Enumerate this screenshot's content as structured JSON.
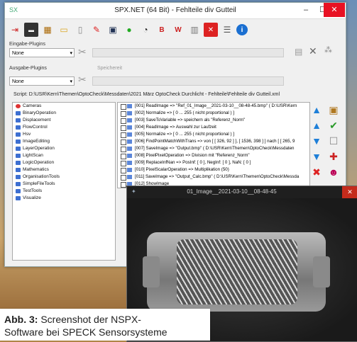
{
  "window": {
    "title": "SPX.NET (64 Bit) - Fehlteile div Gutteil",
    "app_icon": "SX",
    "controls": {
      "minimize": "–",
      "maximize": "☐",
      "close": "✕"
    }
  },
  "toolbar_icons": [
    "exit-icon",
    "screen-icon",
    "calculator-icon",
    "open-folder-icon",
    "new-document-icon",
    "pen-icon",
    "save-icon",
    "run-icon",
    "timer-icon",
    "record-icon",
    "stop-w-icon",
    "database-icon",
    "delete-icon",
    "list-icon",
    "info-icon"
  ],
  "input_plugins": {
    "label": "Eingabe-Plugins",
    "value": "None"
  },
  "output_plugins": {
    "label": "Ausgabe-Plugins",
    "value": "None",
    "storage_label": "Speichereit"
  },
  "script_path": "Script: D:\\USR\\Kern\\Themen\\OptoCheck\\Messdaten\\2021 März OptoCheck Durchlicht - Fehlteile\\Fehlteile div Gutteil.xml",
  "categories": [
    {
      "label": "Cameras",
      "icon": "camera-icon"
    },
    {
      "label": "BinaryOperation"
    },
    {
      "label": "Displacement"
    },
    {
      "label": "FlowControl"
    },
    {
      "label": "Hsv"
    },
    {
      "label": "ImageEditing"
    },
    {
      "label": "LayerOperation"
    },
    {
      "label": "LightScan"
    },
    {
      "label": "LogicOperation"
    },
    {
      "label": "Mathematics"
    },
    {
      "label": "OrganisationTools"
    },
    {
      "label": "SimpleFileTools"
    },
    {
      "label": "TestTools"
    },
    {
      "label": "Visualize"
    }
  ],
  "steps": [
    "[001] ReadImage => \"Ref_01_Image__2021-03-10__08-48-45.bmp\" ( D:\\USR\\Kern",
    "[002] Normalize => [ 0 ... 255 ( nicht proportional ) ]",
    "[003] SaveToVariable => speichern als \"Referenz_Norm\"",
    "[004] ReadImage => Auswahl zur Laufzeit",
    "[005] Normalize => [ 0 ... 255 ( nicht proportional ) ]",
    "[006] FindPointMatchWithTrans => von [ [ 326, 92 ] ], [ 1536, 398 ] ] nach [ [ 265, 9",
    "[007] SaveImage => \"Output.bmp\" ( D:\\USR\\Kern\\Themen\\OptoCheck\\Messdaten",
    "[008] PixelPixelOperation => Division mit \"Referenz_Norm\"",
    "[009] ReplaceInfNan => PosInf: [ 0 ], NegInf: [ 0 ], NaN: [ 0 ]",
    "[010] PixelScalarOperation => Multiplikation (50)",
    "[011] SaveImage => \"Output_Calc.bmp\" ( D:\\USR\\Kern\\Themen\\OptoCheck\\Messda",
    "[012] ShowImage"
  ],
  "image_window": {
    "title": "01_Image__2021-03-10__08-48-45",
    "close": "✕"
  },
  "caption": {
    "bold": "Abb. 3:",
    "line1": " Screenshot der NSPX-",
    "line2": "Software bei SPECK Sensorsysteme"
  }
}
